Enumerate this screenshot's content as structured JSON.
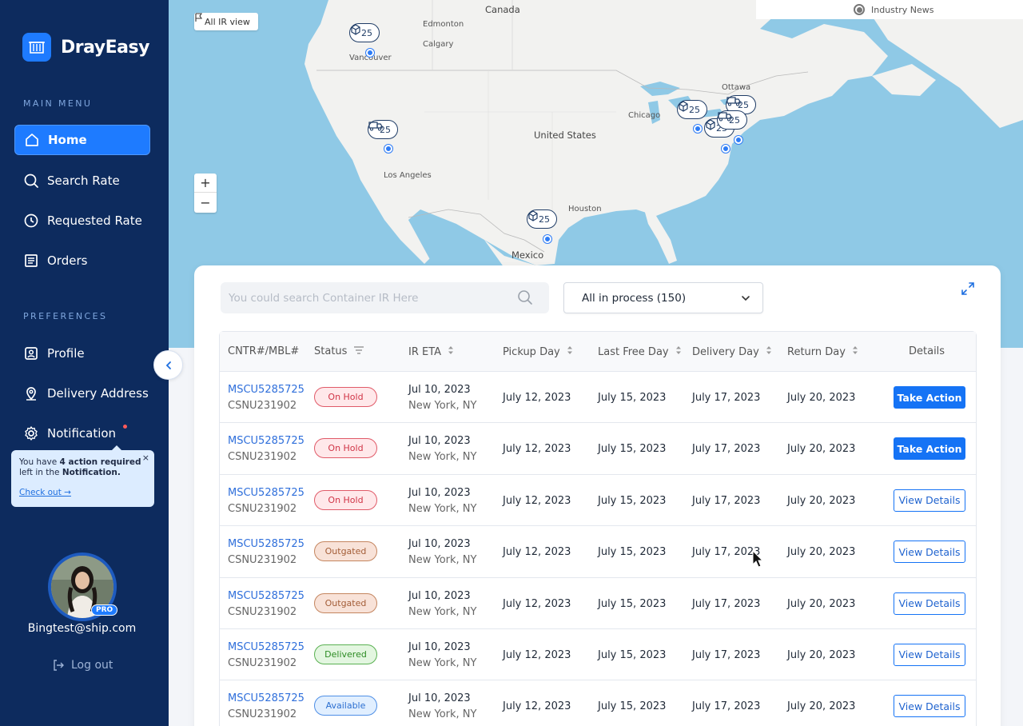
{
  "brand": {
    "name": "DrayEasy"
  },
  "sidebar": {
    "main_menu_label": "MAIN MENU",
    "preferences_label": "PREFERENCES",
    "main_items": [
      {
        "label": "Home",
        "icon": "home-icon"
      },
      {
        "label": "Search Rate",
        "icon": "search-icon"
      },
      {
        "label": "Requested Rate",
        "icon": "history-icon"
      },
      {
        "label": "Orders",
        "icon": "orders-icon"
      }
    ],
    "pref_items": [
      {
        "label": "Profile",
        "icon": "profile-icon"
      },
      {
        "label": "Delivery Address",
        "icon": "location-icon"
      },
      {
        "label": "Notification",
        "icon": "gear-icon"
      }
    ],
    "tooltip": {
      "pre": "You have ",
      "count": "4 action required",
      "mid": " left in the ",
      "target": "Notification.",
      "link": "Check out →",
      "close": "×"
    },
    "user": {
      "email": "Bingtest@ship.com",
      "badge": "PRO"
    },
    "logout": "Log out"
  },
  "map": {
    "all_ir_label": "All IR view",
    "news_label": "Industry News",
    "zoom_in": "+",
    "zoom_out": "−",
    "places": {
      "canada": "Canada",
      "edmonton": "Edmonton",
      "calgary": "Calgary",
      "vancouver": "Vancouver",
      "ottawa": "Ottawa",
      "chicago": "Chicago",
      "united_states": "United States",
      "los_angeles": "Los Angeles",
      "houston": "Houston",
      "mexico": "Mexico"
    },
    "markers": [
      {
        "icon": "box-icon",
        "count": "25"
      },
      {
        "icon": "truck-icon",
        "count": "25"
      },
      {
        "icon": "box-icon",
        "count": "25"
      },
      {
        "icon": "truck-icon",
        "count": "25"
      },
      {
        "icon": "box-icon",
        "count": "25"
      },
      {
        "icon": "truck-icon",
        "count": "25"
      },
      {
        "icon": "box-icon",
        "count": "25"
      }
    ]
  },
  "panel": {
    "search_placeholder": "You could search Container IR Here",
    "filter_value": "All in process (150)",
    "columns": [
      "CNTR#/MBL#",
      "Status",
      "IR ETA",
      "Pickup Day",
      "Last Free Day",
      "Delivery Day",
      "Return Day",
      "Details"
    ],
    "rows": [
      {
        "cntr": "MSCU5285725",
        "mbl": "CSNU231902",
        "status": "On Hold",
        "eta": "Jul 10, 2023",
        "loc": "New York, NY",
        "pickup": "July 12, 2023",
        "lfd": "July 15, 2023",
        "delivery": "July 17, 2023",
        "return": "July 20, 2023",
        "action": "Take Action"
      },
      {
        "cntr": "MSCU5285725",
        "mbl": "CSNU231902",
        "status": "On Hold",
        "eta": "Jul 10, 2023",
        "loc": "New York, NY",
        "pickup": "July 12, 2023",
        "lfd": "July 15, 2023",
        "delivery": "July 17, 2023",
        "return": "July 20, 2023",
        "action": "Take Action"
      },
      {
        "cntr": "MSCU5285725",
        "mbl": "CSNU231902",
        "status": "On Hold",
        "eta": "Jul 10, 2023",
        "loc": "New York, NY",
        "pickup": "July 12, 2023",
        "lfd": "July 15, 2023",
        "delivery": "July 17, 2023",
        "return": "July 20, 2023",
        "action": "View Details"
      },
      {
        "cntr": "MSCU5285725",
        "mbl": "CSNU231902",
        "status": "Outgated",
        "eta": "Jul 10, 2023",
        "loc": "New York, NY",
        "pickup": "July 12, 2023",
        "lfd": "July 15, 2023",
        "delivery": "July 17, 2023",
        "return": "July 20, 2023",
        "action": "View Details"
      },
      {
        "cntr": "MSCU5285725",
        "mbl": "CSNU231902",
        "status": "Outgated",
        "eta": "Jul 10, 2023",
        "loc": "New York, NY",
        "pickup": "July 12, 2023",
        "lfd": "July 15, 2023",
        "delivery": "July 17, 2023",
        "return": "July 20, 2023",
        "action": "View Details"
      },
      {
        "cntr": "MSCU5285725",
        "mbl": "CSNU231902",
        "status": "Delivered",
        "eta": "Jul 10, 2023",
        "loc": "New York, NY",
        "pickup": "July 12, 2023",
        "lfd": "July 15, 2023",
        "delivery": "July 17, 2023",
        "return": "July 20, 2023",
        "action": "View Details"
      },
      {
        "cntr": "MSCU5285725",
        "mbl": "CSNU231902",
        "status": "Available",
        "eta": "Jul 10, 2023",
        "loc": "New York, NY",
        "pickup": "July 12, 2023",
        "lfd": "July 15, 2023",
        "delivery": "July 17, 2023",
        "return": "July 20, 2023",
        "action": "View Details"
      }
    ]
  },
  "colors": {
    "sidebar_bg": "#0d2b5e",
    "accent": "#1e7bff",
    "map_water": "#8fc9e6",
    "map_land": "#f2f2f0",
    "on_hold": "#d03446",
    "outgated": "#a35d37",
    "delivered": "#2c8b23",
    "available": "#2c6fd0"
  }
}
